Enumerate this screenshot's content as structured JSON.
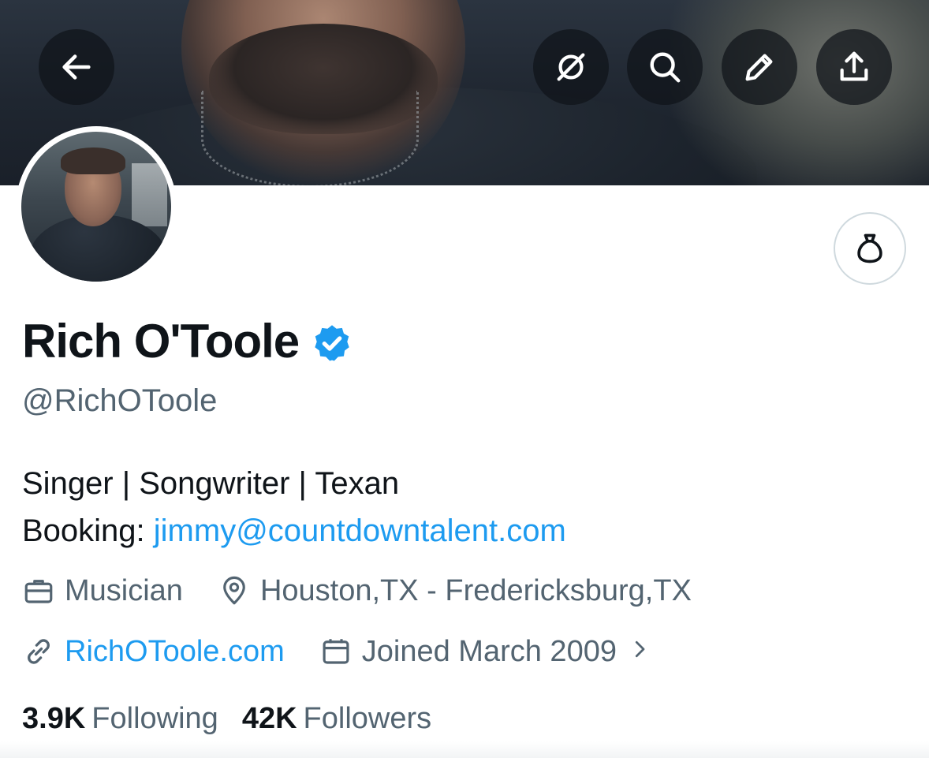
{
  "header": {
    "icons": {
      "back": "arrow-left-icon",
      "hide": "eye-off-slash-icon",
      "search": "search-icon",
      "edit": "pencil-icon",
      "share": "share-upload-icon"
    }
  },
  "profile": {
    "name": "Rich O'Toole",
    "verified": true,
    "handle": "@RichOToole",
    "bio_line1": "Singer | Songwriter | Texan",
    "bio_prefix": "Booking: ",
    "bio_link": "jimmy@countdowntalent.com",
    "profession": "Musician",
    "location": "Houston,TX - Fredericksburg,TX",
    "website": "RichOToole.com",
    "joined": "Joined March 2009",
    "following_count": "3.9K",
    "following_label": "Following",
    "followers_count": "42K",
    "followers_label": "Followers"
  },
  "colors": {
    "accent": "#1d9bf0",
    "muted": "#536471",
    "text": "#0f1419",
    "border": "#cfd9de"
  }
}
